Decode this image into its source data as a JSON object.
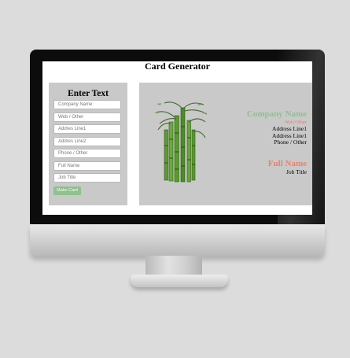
{
  "app": {
    "title": "Card Generator"
  },
  "form": {
    "heading": "Enter Text",
    "fields": [
      {
        "placeholder": "Company Name"
      },
      {
        "placeholder": "Web / Other"
      },
      {
        "placeholder": "Addres Line1"
      },
      {
        "placeholder": "Addres Line2"
      },
      {
        "placeholder": "Phone / Other"
      },
      {
        "placeholder": "Full Name"
      },
      {
        "placeholder": "Job Title"
      }
    ],
    "submit_label": "Make Card"
  },
  "card": {
    "company_name": "Company Name",
    "web": "Web/Other",
    "address_line1": "Address Line1",
    "address_line2": "Address Line1",
    "phone": "Phone / Other",
    "full_name": "Full Name",
    "job_title": "Job Title",
    "image": "bamboo-image"
  },
  "colors": {
    "accent_green": "#8fbf8f",
    "accent_coral": "#f07e6e",
    "panel_gray": "#c9c9c9"
  }
}
